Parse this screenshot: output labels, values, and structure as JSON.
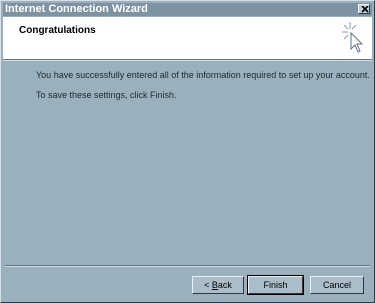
{
  "window": {
    "title": "Internet Connection Wizard",
    "close_icon": "close-icon"
  },
  "header": {
    "title": "Congratulations",
    "icon": "wizard-star-cursor-icon"
  },
  "body": {
    "line1": "You have successfully entered all of the information required to set up your account.",
    "line2": "To save these settings, click Finish."
  },
  "buttons": {
    "back_arrow": "<",
    "back_mnemonic": "B",
    "back_rest": "ack",
    "finish": "Finish",
    "cancel": "Cancel"
  },
  "colors": {
    "dialog_bg": "#9bb0bd",
    "titlebar_bg": "#7e93a2",
    "header_bg": "#ffffff"
  }
}
